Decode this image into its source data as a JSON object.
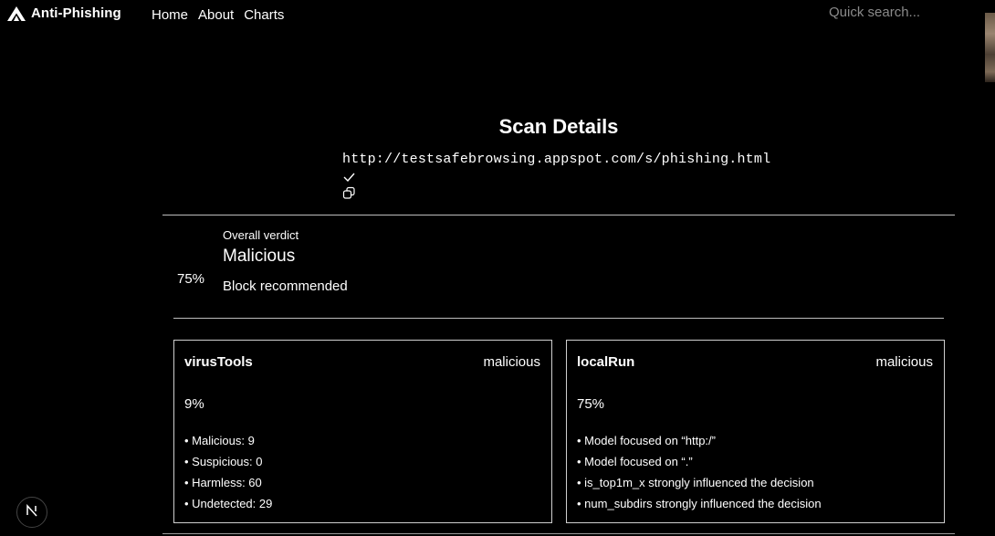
{
  "header": {
    "brand": "Anti-Phishing",
    "nav": [
      {
        "label": "Home"
      },
      {
        "label": "About"
      },
      {
        "label": "Charts"
      }
    ],
    "search_placeholder": "Quick search..."
  },
  "scan": {
    "title": "Scan Details",
    "url": "http://testsafebrowsing.appspot.com/s/phishing.html",
    "icons": [
      "check-icon",
      "copy-icon"
    ]
  },
  "verdict": {
    "percent": "75%",
    "label": "Overall verdict",
    "value": "Malicious",
    "recommendation": "Block recommended"
  },
  "cards": [
    {
      "title": "virusTools",
      "status": "malicious",
      "percent": "9%",
      "items": [
        "Malicious: 9",
        "Suspicious: 0",
        "Harmless: 60",
        "Undetected: 29"
      ]
    },
    {
      "title": "localRun",
      "status": "malicious",
      "percent": "75%",
      "items": [
        "Model focused on “http:/”",
        "Model focused on “.”",
        "is_top1m_x strongly influenced the decision",
        "num_subdirs strongly influenced the decision"
      ]
    }
  ],
  "badge": {
    "icon": "nextjs-n-icon"
  }
}
